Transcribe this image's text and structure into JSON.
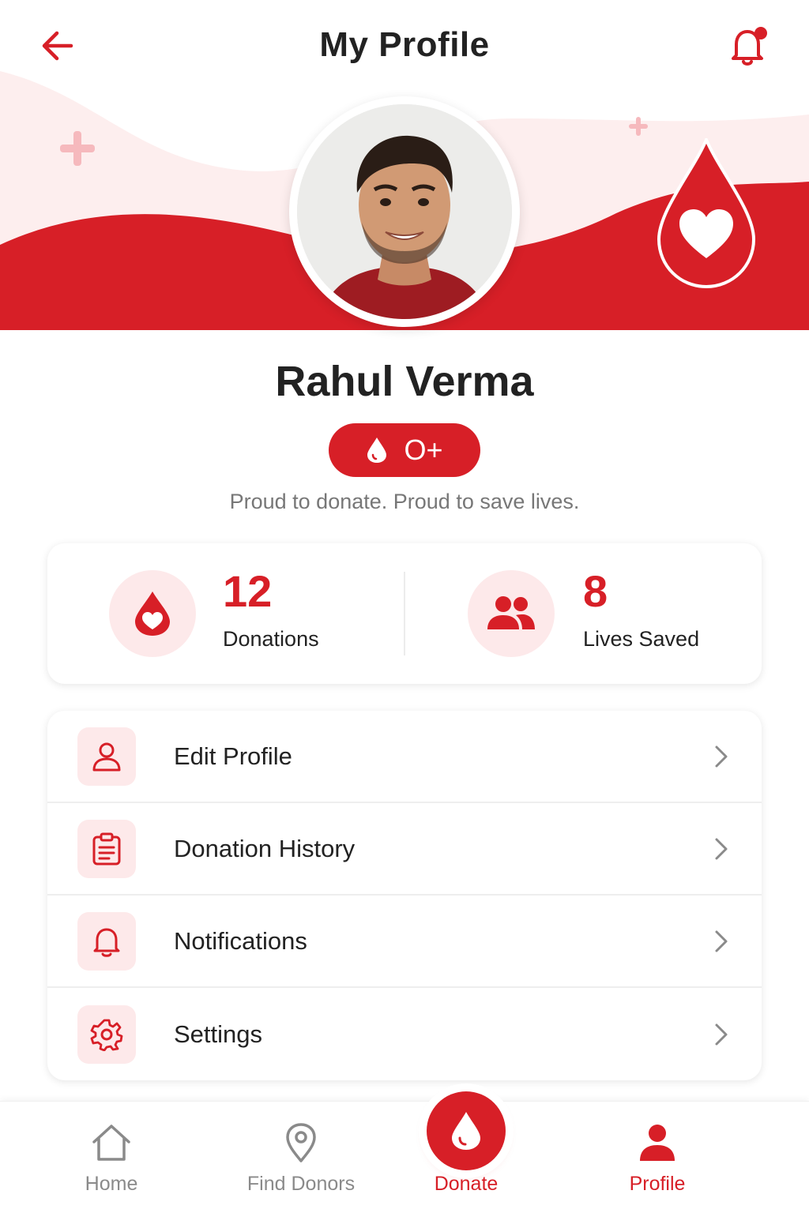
{
  "header": {
    "title": "My Profile",
    "has_unread_notifications": true
  },
  "profile": {
    "name": "Rahul Verma",
    "blood_group": "O+",
    "tagline": "Proud to donate. Proud to save lives."
  },
  "stats": [
    {
      "value": "12",
      "label": "Donations",
      "icon": "blood-drop-heart-icon"
    },
    {
      "value": "8",
      "label": "Lives Saved",
      "icon": "people-icon"
    }
  ],
  "menu": [
    {
      "label": "Edit Profile",
      "icon": "user-icon"
    },
    {
      "label": "Donation History",
      "icon": "clipboard-icon"
    },
    {
      "label": "Notifications",
      "icon": "bell-icon"
    },
    {
      "label": "Settings",
      "icon": "gear-icon"
    }
  ],
  "bottom_nav": [
    {
      "label": "Home",
      "icon": "home-icon",
      "active": false
    },
    {
      "label": "Find Donors",
      "icon": "location-pin-icon",
      "active": false
    },
    {
      "label": "Donate",
      "icon": "blood-drop-icon",
      "active": false
    },
    {
      "label": "Profile",
      "icon": "user-icon",
      "active": true
    }
  ],
  "colors": {
    "accent": "#d71f27",
    "accent_light": "#fde9ea",
    "text_dark": "#222222",
    "text_muted": "#777777",
    "nav_inactive": "#8a8a8a"
  }
}
